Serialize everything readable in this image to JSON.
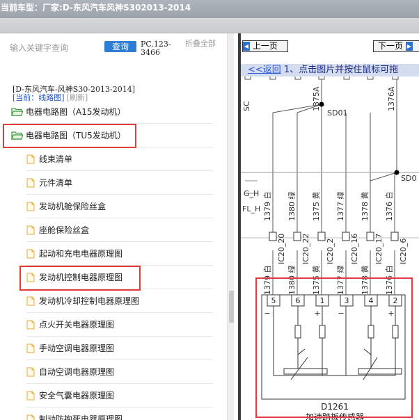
{
  "header": {
    "label": "当前车型：",
    "value": "厂家:D-东风汽车风神S302013-2014"
  },
  "search": {
    "placeholder": "输入关键字查询",
    "button": "查询",
    "code": "PC.123-3466",
    "collapse_all": "折叠全部"
  },
  "tree": {
    "vehicle": "[D-东风汽车-风神S30-2013-2014]",
    "current_label": "[当前：线路图]",
    "refresh": "[刷新]",
    "items": [
      {
        "label": "电器电路图（A15发动机）"
      },
      {
        "label": "电器电路图（TU5发动机）"
      }
    ],
    "children": [
      {
        "label": "线束清单"
      },
      {
        "label": "元件清单"
      },
      {
        "label": "发动机舱保险丝盒"
      },
      {
        "label": "座舱保险丝盒"
      },
      {
        "label": "起动和充电电器原理图"
      },
      {
        "label": "发动机控制电器原理图"
      },
      {
        "label": "发动机冷却控制电器原理图"
      },
      {
        "label": "点火开关电器原理图"
      },
      {
        "label": "手动空调电器原理图"
      },
      {
        "label": "自动空调电器原理图"
      },
      {
        "label": "安全气囊电器原理图"
      },
      {
        "label": "制动防抱死电器原理图"
      }
    ]
  },
  "viewer": {
    "prev": "上一页",
    "next": "下一页",
    "back": "<<返回",
    "instruction": " 1、点击图片并按住鼠标可拖"
  },
  "diagram": {
    "top_labels": [
      "SC",
      "1375A",
      "1376A"
    ],
    "node_labels": [
      "SD01",
      "SD0"
    ],
    "left_labels": [
      "G_H",
      "FL_H"
    ],
    "wires": [
      {
        "top": "1379 白",
        "ic": "IC20_20",
        "bottom": "1379 白"
      },
      {
        "top": "1380 绿",
        "ic": "IC20_22",
        "bottom": "1380 绿"
      },
      {
        "top": "1375 黄",
        "ic": "IC20_2",
        "bottom": "1375 黄"
      },
      {
        "top": "1377 绿",
        "ic": "IC20_16",
        "bottom": "1377 绿"
      },
      {
        "top": "1378 黄",
        "ic": "IC20_17",
        "bottom": "1378 黄"
      },
      {
        "top": "1376 白",
        "ic": "IC20_6",
        "bottom": "1376 白"
      }
    ],
    "pins": [
      "5",
      "6",
      "1",
      "3",
      "4",
      "2"
    ],
    "polarity": [
      "−",
      "+",
      "−",
      "+"
    ],
    "component_code": "D1261",
    "component_name": "加速踏板传感器"
  }
}
